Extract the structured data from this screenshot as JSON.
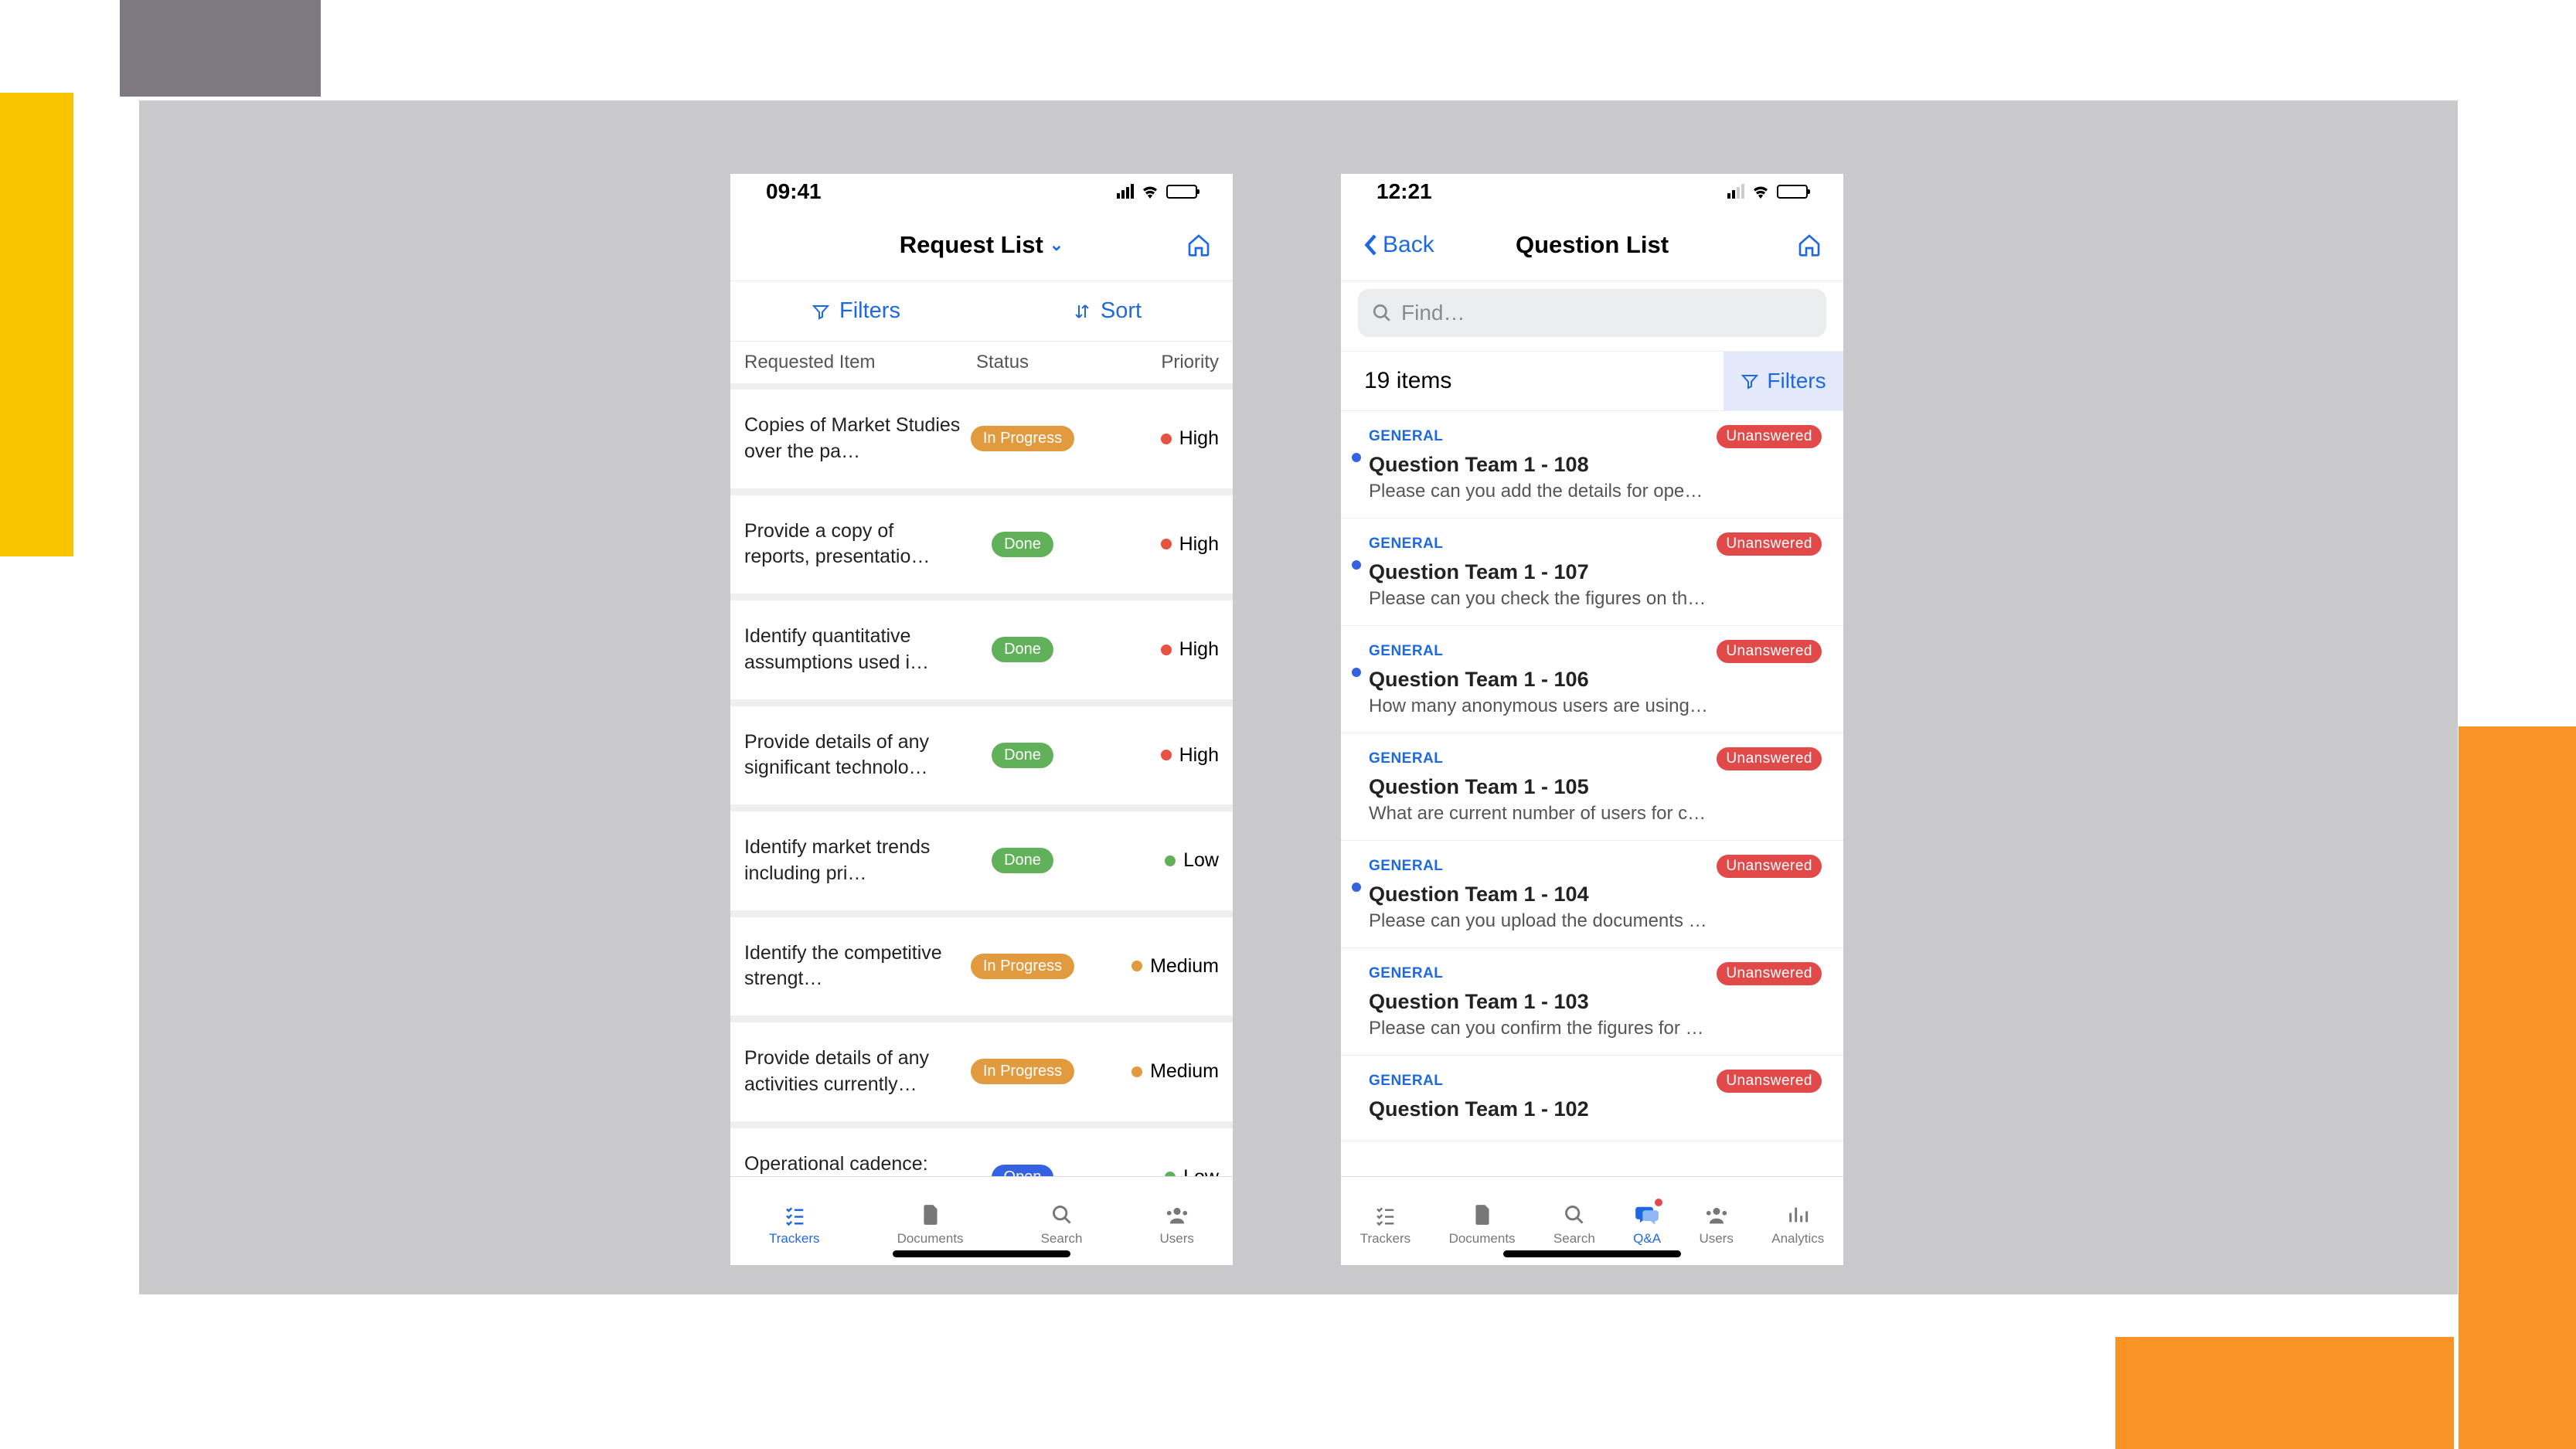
{
  "phone1": {
    "status": {
      "time": "09:41"
    },
    "nav": {
      "title": "Request List"
    },
    "toolbar": {
      "filters": "Filters",
      "sort": "Sort"
    },
    "columns": {
      "item": "Requested Item",
      "status": "Status",
      "priority": "Priority"
    },
    "rows": [
      {
        "text": "Copies of Market Studies over the pa…",
        "status": "In Progress",
        "statusClass": "pill-progress",
        "priority": "High",
        "dot": "dot-red"
      },
      {
        "text": "Provide a copy of reports, presentatio…",
        "status": "Done",
        "statusClass": "pill-done",
        "priority": "High",
        "dot": "dot-red"
      },
      {
        "text": "Identify quantitative assumptions used i…",
        "status": "Done",
        "statusClass": "pill-done",
        "priority": "High",
        "dot": "dot-red"
      },
      {
        "text": "Provide details of any significant technolo…",
        "status": "Done",
        "statusClass": "pill-done",
        "priority": "High",
        "dot": "dot-red"
      },
      {
        "text": "Identify market trends including pri…",
        "status": "Done",
        "statusClass": "pill-done",
        "priority": "Low",
        "dot": "dot-green"
      },
      {
        "text": "Identify the competitive strengt…",
        "status": "In Progress",
        "statusClass": "pill-progress",
        "priority": "Medium",
        "dot": "dot-orange"
      },
      {
        "text": "Provide details of any activities currently…",
        "status": "In Progress",
        "statusClass": "pill-progress",
        "priority": "Medium",
        "dot": "dot-orange"
      },
      {
        "text": "Operational cadence: provide full year cal…",
        "status": "Open",
        "statusClass": "pill-open",
        "priority": "Low",
        "dot": "dot-green"
      }
    ],
    "tabs": {
      "trackers": "Trackers",
      "documents": "Documents",
      "search": "Search",
      "users": "Users"
    }
  },
  "phone2": {
    "status": {
      "time": "12:21"
    },
    "nav": {
      "back": "Back",
      "title": "Question List"
    },
    "search": {
      "placeholder": "Find…"
    },
    "count": "19 items",
    "filters": "Filters",
    "rows": [
      {
        "cat": "GENERAL",
        "title": "Question Team 1 - 108",
        "excerpt": "Please can you add the details for operat…",
        "badge": "Unanswered",
        "unread": true
      },
      {
        "cat": "GENERAL",
        "title": "Question Team 1 - 107",
        "excerpt": "Please can you check the figures on the…",
        "badge": "Unanswered",
        "unread": true
      },
      {
        "cat": "GENERAL",
        "title": "Question Team 1 - 106",
        "excerpt": "How many anonymous users are using y…",
        "badge": "Unanswered",
        "unread": true
      },
      {
        "cat": "GENERAL",
        "title": "Question Team 1 - 105",
        "excerpt": "What are current number of users for cur…",
        "badge": "Unanswered",
        "unread": false
      },
      {
        "cat": "GENERAL",
        "title": "Question Team 1 - 104",
        "excerpt": "Please can you upload the documents co…",
        "badge": "Unanswered",
        "unread": true
      },
      {
        "cat": "GENERAL",
        "title": "Question Team 1 - 103",
        "excerpt": "Please can you confirm the figures for FY…",
        "badge": "Unanswered",
        "unread": false
      },
      {
        "cat": "GENERAL",
        "title": "Question Team 1 - 102",
        "excerpt": "",
        "badge": "Unanswered",
        "unread": false
      }
    ],
    "tabs": {
      "trackers": "Trackers",
      "documents": "Documents",
      "search": "Search",
      "qa": "Q&A",
      "users": "Users",
      "analytics": "Analytics"
    }
  }
}
